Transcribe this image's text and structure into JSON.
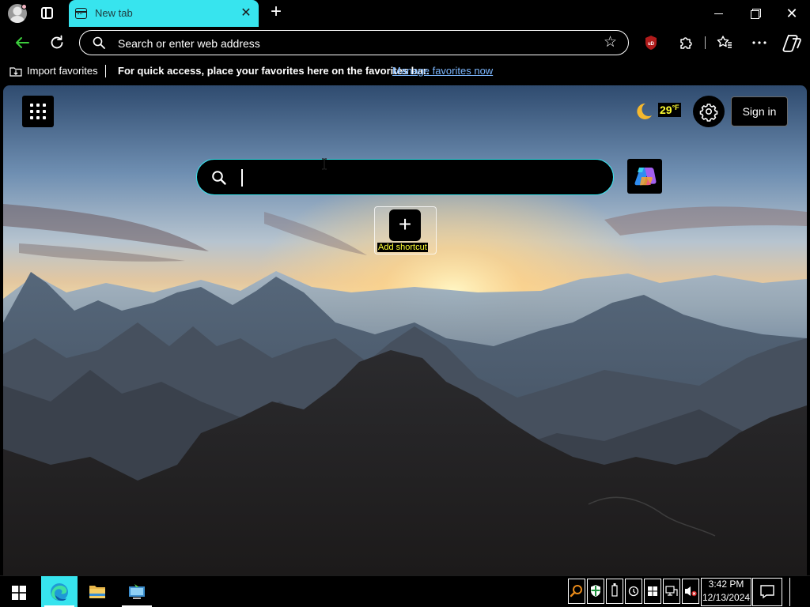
{
  "browser": {
    "tab": {
      "title": "New tab",
      "close_glyph": "✕"
    },
    "new_tab_glyph": "+",
    "window_controls": {
      "close_glyph": "✕"
    },
    "address_bar": {
      "placeholder": "Search or enter web address",
      "star_glyph": "☆"
    },
    "toolbar_icons": [
      "back-arrow-icon",
      "refresh-icon",
      "favorite-star-icon",
      "ublock-icon",
      "extensions-icon",
      "favorites-icon",
      "more-icon",
      "copilot-icon"
    ],
    "favorites_bar": {
      "import_label": "Import favorites",
      "message": "For quick access, place your favorites here on the favorites bar.",
      "link_label": "Manage favorites now"
    }
  },
  "ntp": {
    "weather": {
      "temperature": "29",
      "unit": "°F",
      "icon": "moon-icon"
    },
    "sign_in_label": "Sign in",
    "search_value": "",
    "shortcut": {
      "plus_glyph": "+",
      "label": "Add shortcut"
    }
  },
  "taskbar": {
    "time": "3:42 PM",
    "date": "12/13/2024",
    "pinned": [
      "edge-icon",
      "file-explorer-icon",
      "remote-desktop-icon"
    ]
  },
  "colors": {
    "accent": "#37e4ee",
    "back_arrow": "#3ccf3c",
    "link": "#7cb7ff",
    "highlight_text": "#ffff33"
  }
}
